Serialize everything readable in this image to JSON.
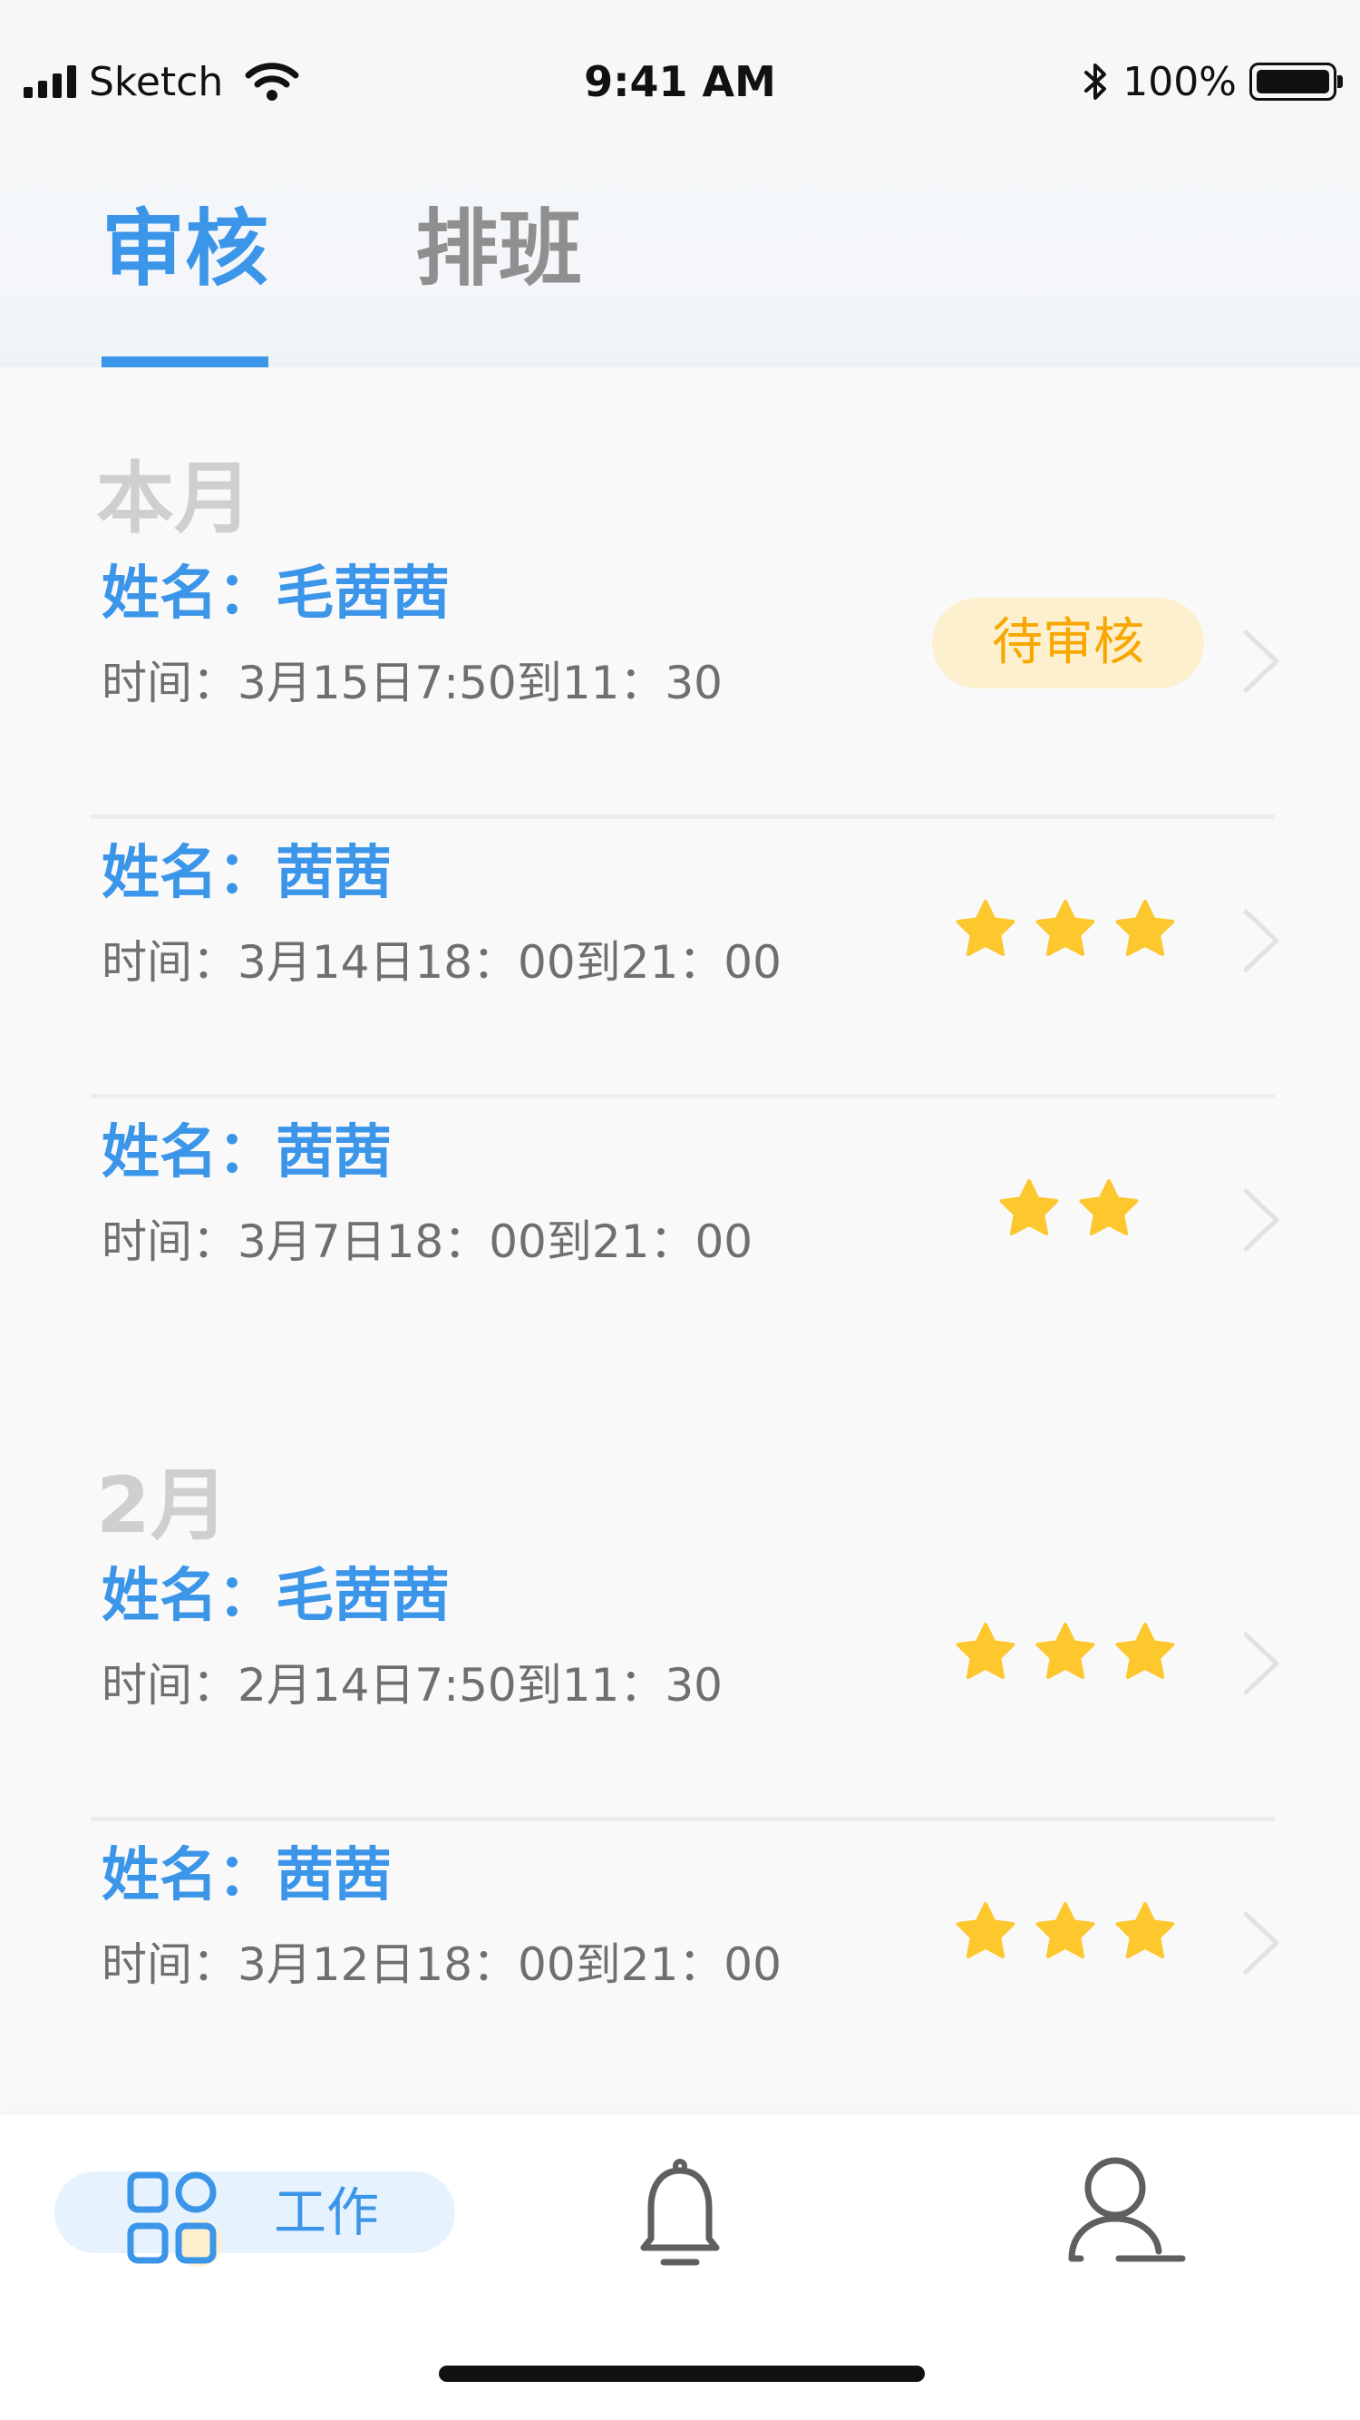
{
  "status_bar": {
    "carrier": "Sketch",
    "time": "9:41 AM",
    "battery": "100%"
  },
  "tabs": [
    {
      "label": "审核",
      "active": true
    },
    {
      "label": "排班",
      "active": false
    }
  ],
  "sections": [
    {
      "title": "本月",
      "records": [
        {
          "name": "姓名：毛茜茜",
          "time": "时间：3月15日7:50到11：30",
          "status": "待审核",
          "rating": null
        },
        {
          "name": "姓名：茜茜",
          "time": "时间：3月14日18：00到21：00",
          "status": null,
          "rating": 3
        },
        {
          "name": "姓名：茜茜",
          "time": "时间：3月7日18：00到21：00",
          "status": null,
          "rating": 2
        }
      ]
    },
    {
      "title": "2月",
      "records": [
        {
          "name": "姓名：毛茜茜",
          "time": "时间：2月14日7:50到11：30",
          "status": null,
          "rating": 3
        },
        {
          "name": "姓名：茜茜",
          "time": "时间：3月12日18：00到21：00",
          "status": null,
          "rating": 3
        }
      ]
    }
  ],
  "bottom_nav": {
    "items": [
      {
        "label": "工作",
        "icon": "grid-apps-icon",
        "active": true
      },
      {
        "label": "",
        "icon": "bell-icon",
        "active": false
      },
      {
        "label": "",
        "icon": "user-icon",
        "active": false
      }
    ]
  },
  "colors": {
    "accent": "#3b95e8",
    "star": "#fdc72e",
    "pending_bg": "#fdf0cf",
    "pending_text": "#f7a700",
    "section_title": "#cfcfcf",
    "secondary_text": "#6f6f6f"
  }
}
